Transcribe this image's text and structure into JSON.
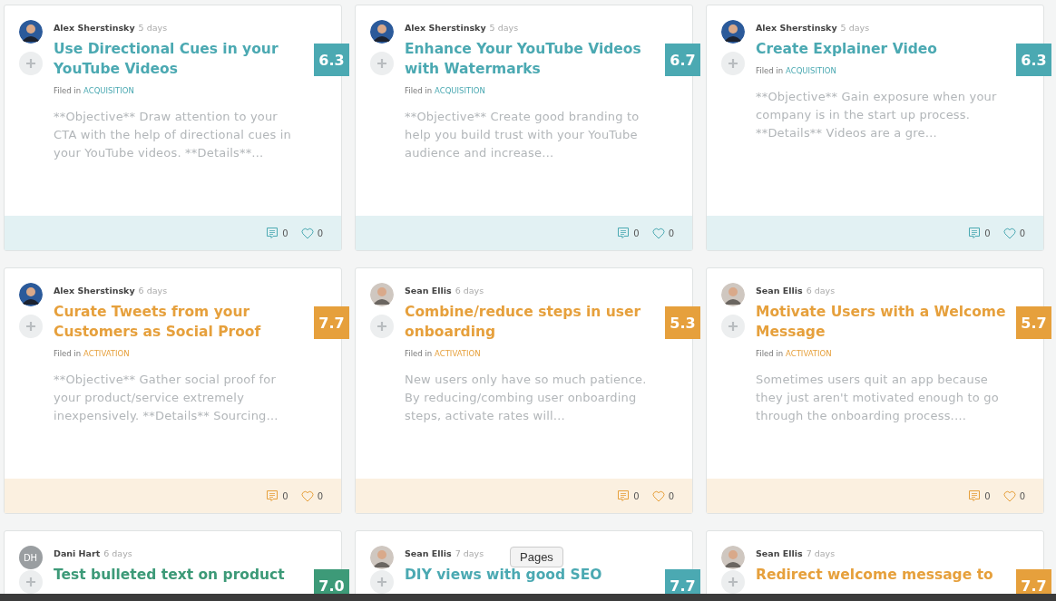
{
  "cards": [
    {
      "author": "Alex Sherstinsky",
      "age": "5 days",
      "avatar": {
        "kind": "photo"
      },
      "title": "Use Directional Cues in your YouTube Videos",
      "score": "6.3",
      "color": "#4ba9b2",
      "filed_label": "Filed in",
      "category": "ACQUISITION",
      "description": "**Objective** Draw attention to your CTA with the help of directional cues in your YouTube videos. **Details**…",
      "comments": "0",
      "likes": "0"
    },
    {
      "author": "Alex Sherstinsky",
      "age": "5 days",
      "avatar": {
        "kind": "photo"
      },
      "title": "Enhance Your YouTube Videos with Watermarks",
      "score": "6.7",
      "color": "#4ba9b2",
      "filed_label": "Filed in",
      "category": "ACQUISITION",
      "description": "**Objective** Create good branding to help you build trust with your YouTube audience and increase…",
      "comments": "0",
      "likes": "0"
    },
    {
      "author": "Alex Sherstinsky",
      "age": "5 days",
      "avatar": {
        "kind": "photo"
      },
      "title": "Create Explainer Video",
      "score": "6.3",
      "color": "#4ba9b2",
      "filed_label": "Filed in",
      "category": "ACQUISITION",
      "description": "**Objective** Gain exposure when your company is in the start up process. **Details** Videos are a gre…",
      "comments": "0",
      "likes": "0"
    },
    {
      "author": "Alex Sherstinsky",
      "age": "6 days",
      "avatar": {
        "kind": "photo"
      },
      "title": "Curate Tweets from your Customers as Social Proof",
      "score": "7.7",
      "color": "#e6a03c",
      "filed_label": "Filed in",
      "category": "ACTIVATION",
      "description": "**Objective** Gather social proof for your product/service extremely inexpensively. **Details** Sourcing…",
      "comments": "0",
      "likes": "0"
    },
    {
      "author": "Sean Ellis",
      "age": "6 days",
      "avatar": {
        "kind": "photo"
      },
      "title": "Combine/reduce steps in user onboarding",
      "score": "5.3",
      "color": "#e6a03c",
      "filed_label": "Filed in",
      "category": "ACTIVATION",
      "description": "New users only have so much patience. By reducing/combing user onboarding steps, activate rates will…",
      "comments": "0",
      "likes": "0"
    },
    {
      "author": "Sean Ellis",
      "age": "6 days",
      "avatar": {
        "kind": "photo"
      },
      "title": "Motivate Users with a Welcome Message",
      "score": "5.7",
      "color": "#e6a03c",
      "filed_label": "Filed in",
      "category": "ACTIVATION",
      "description": "Sometimes users quit an app because they just aren't motivated enough to go through the onboarding process.…",
      "comments": "0",
      "likes": "0"
    },
    {
      "author": "Dani Hart",
      "age": "6 days",
      "avatar": {
        "kind": "initials",
        "text": "DH"
      },
      "title": "Test bulleted text on product",
      "score": "7.0",
      "color": "#3d9a78"
    },
    {
      "author": "Sean Ellis",
      "age": "7 days",
      "avatar": {
        "kind": "photo"
      },
      "title": "DIY views with good SEO",
      "score": "7.7",
      "color": "#4ba9b2"
    },
    {
      "author": "Sean Ellis",
      "age": "7 days",
      "avatar": {
        "kind": "photo"
      },
      "title": "Redirect welcome message to",
      "score": "7.7",
      "color": "#e6a03c"
    }
  ],
  "tooltip": {
    "text": "Pages"
  }
}
